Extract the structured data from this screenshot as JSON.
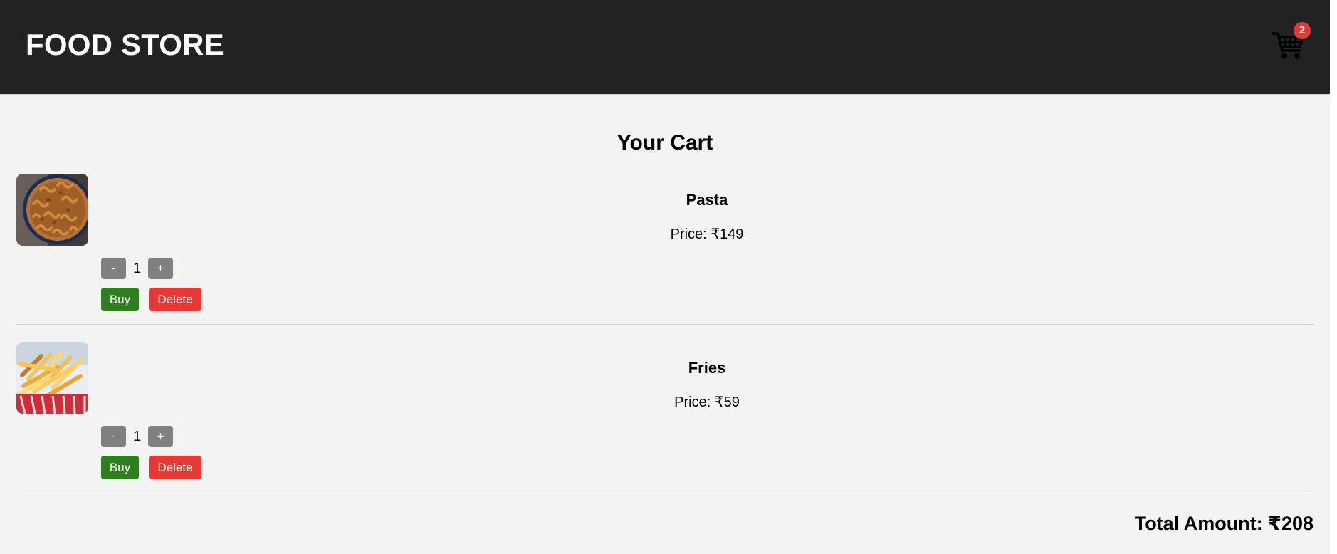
{
  "header": {
    "title": "FOOD STORE",
    "cart_icon": "shopping-cart-icon",
    "cart_count": "2"
  },
  "main": {
    "title": "Your Cart",
    "items": [
      {
        "name": "Pasta",
        "price": "Price: ₹149",
        "quantity": "1",
        "minus_label": "-",
        "plus_label": "+",
        "buy_label": "Buy",
        "delete_label": "Delete",
        "image_icon": "pasta-image"
      },
      {
        "name": "Fries",
        "price": "Price: ₹59",
        "quantity": "1",
        "minus_label": "-",
        "plus_label": "+",
        "buy_label": "Buy",
        "delete_label": "Delete",
        "image_icon": "fries-image"
      }
    ],
    "total": "Total Amount: ₹208"
  },
  "colors": {
    "header_bg": "#222222",
    "page_bg": "#f3f3f3",
    "buy_green": "#2e7d1f",
    "delete_red": "#e53935",
    "quantity_gray": "#808080",
    "badge_red": "#e53935"
  }
}
